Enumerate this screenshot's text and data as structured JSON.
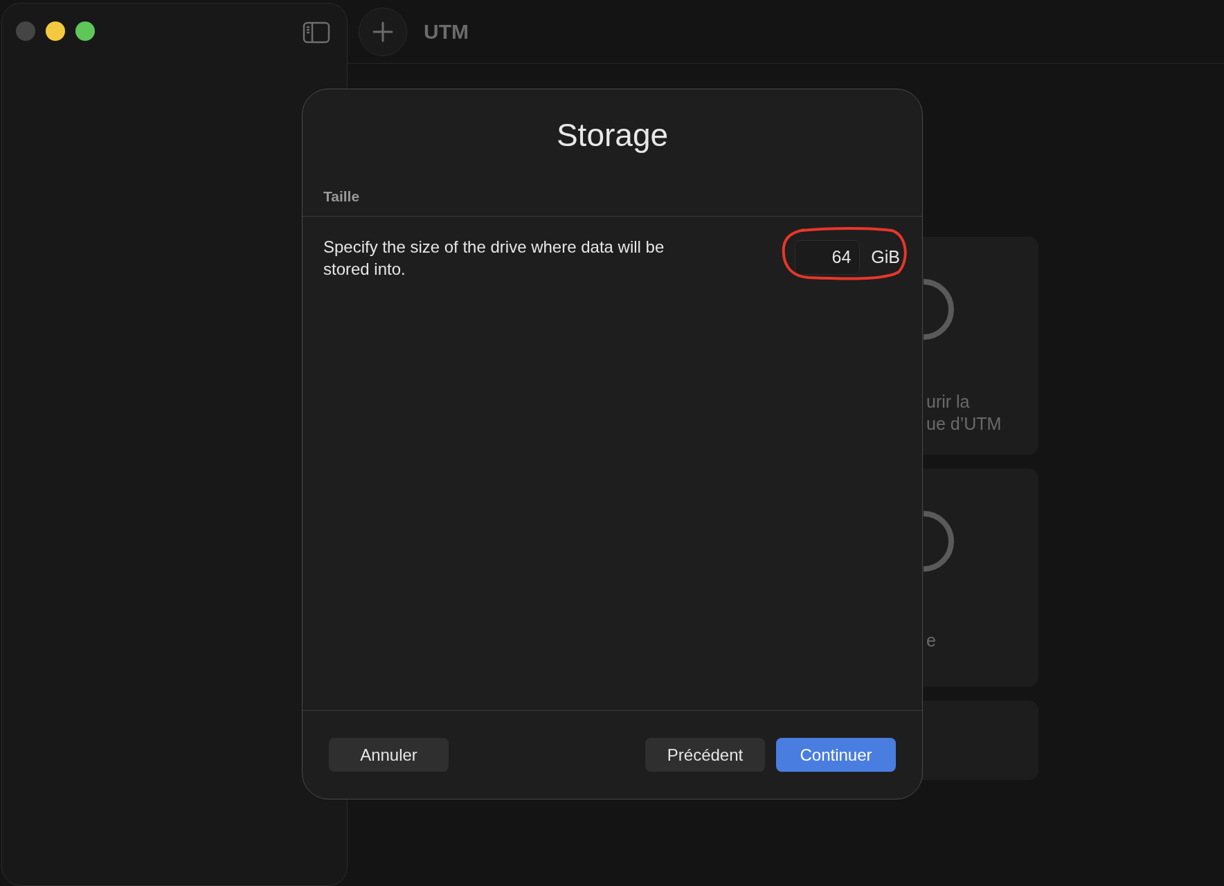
{
  "window": {
    "title": "UTM"
  },
  "background_cards": [
    {
      "kind": "tall",
      "lines": [
        "urir la",
        "ue d’UTM"
      ]
    },
    {
      "kind": "tall",
      "lines": [
        "e"
      ]
    },
    {
      "kind": "short"
    }
  ],
  "dialog": {
    "title": "Storage",
    "section": "Taille",
    "description": "Specify the size of the drive where data will be stored into.",
    "size_field": {
      "value": "64",
      "unit": "GiB",
      "annotated": true
    },
    "buttons": [
      {
        "label": "Annuler",
        "kind": "secondary"
      },
      {
        "label": "Précédent",
        "kind": "secondary"
      },
      {
        "label": "Continuer",
        "kind": "primary"
      }
    ]
  }
}
